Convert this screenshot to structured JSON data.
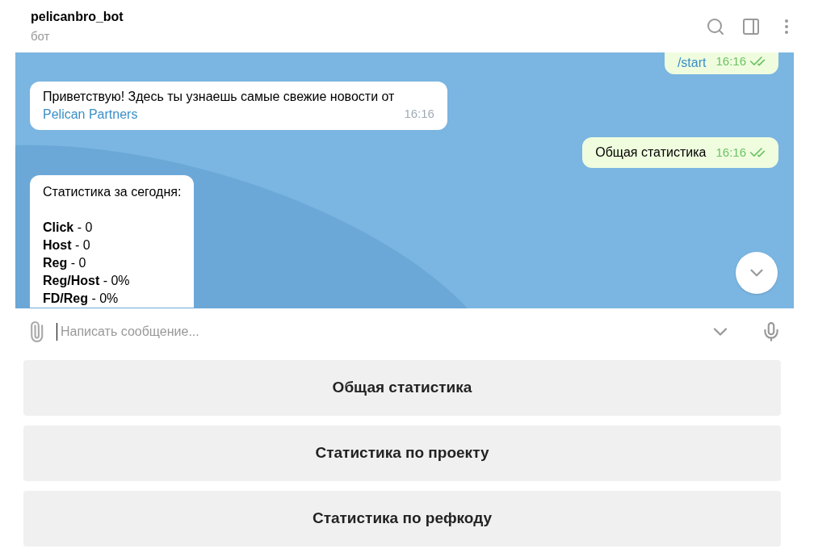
{
  "header": {
    "title": "pelicanbro_bot",
    "subtitle": "бот"
  },
  "messages": [
    {
      "kind": "command",
      "outgoing": true,
      "text": "/start",
      "time": "16:16",
      "read": true
    },
    {
      "kind": "text",
      "outgoing": false,
      "text": "Приветствую! Здесь ты узнаешь самые свежие новости от",
      "link": "Pelican Partners",
      "time": "16:16"
    },
    {
      "kind": "text",
      "outgoing": true,
      "text": "Общая статистика",
      "time": "16:16",
      "read": true
    },
    {
      "kind": "stats",
      "outgoing": false,
      "heading": "Статистика за сегодня:",
      "lines": [
        "**Click** - 0",
        "**Host** - 0",
        "**Reg** - 0",
        "**Reg/Host** - 0%",
        "**FD/Reg** - 0%"
      ]
    }
  ],
  "composer": {
    "placeholder": "Написать сообщение..."
  },
  "keyboard": [
    "Общая статистика",
    "Статистика по проекту",
    "Статистика по рефкоду"
  ]
}
